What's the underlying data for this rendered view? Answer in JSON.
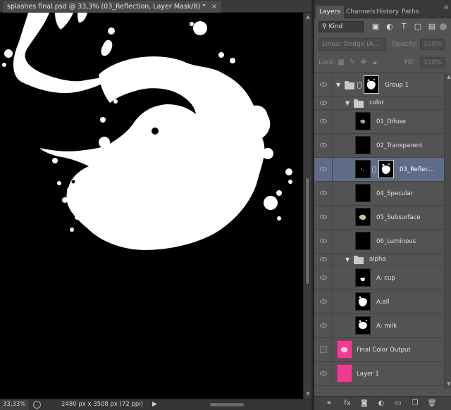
{
  "document": {
    "tab_title": "splashes final.psd @ 33,3% (03_Reflection, Layer Mask/8) *",
    "close_glyph": "×",
    "zoom": "33,33%",
    "doc_info": "2480 px x 3508 px (72 ppi)",
    "play_glyph": "▶",
    "scroll_up": "▲",
    "scroll_down": "▼"
  },
  "panel": {
    "tabs": [
      {
        "label": "Layers"
      },
      {
        "label": "Channels"
      },
      {
        "label": "History"
      },
      {
        "label": "Paths"
      }
    ],
    "menu_glyph": "≡",
    "filter_kind": "Kind",
    "blend_mode": "Linear Dodge (A...",
    "opacity_label": "Opacity:",
    "opacity_value": "100%",
    "lock_label": "Lock:",
    "fill_label": "Fill:",
    "fill_value": "100%",
    "scroll_up": "▲",
    "scroll_down": "▼"
  },
  "layers": [
    {
      "name": "Group 1"
    },
    {
      "name": "color"
    },
    {
      "name": "01_Difuse"
    },
    {
      "name": "02_Transparent"
    },
    {
      "name": "03_Reflec..."
    },
    {
      "name": "04_Specular"
    },
    {
      "name": "05_Subsurface"
    },
    {
      "name": "06_Luminous"
    },
    {
      "name": "alpha"
    },
    {
      "name": "A: cup"
    },
    {
      "name": "A:all"
    },
    {
      "name": "A: milk"
    },
    {
      "name": "Final Color Output"
    },
    {
      "name": "Layer 1"
    }
  ],
  "colors": {
    "selected_row": "#5f6c88",
    "pink_fill": "#f03b95",
    "canvas": "#000000"
  },
  "icons": {
    "footer": [
      "link-icon",
      "fx-icon",
      "mask-icon",
      "adjustment-icon",
      "folder-icon",
      "new-layer-icon",
      "trash-icon"
    ]
  }
}
